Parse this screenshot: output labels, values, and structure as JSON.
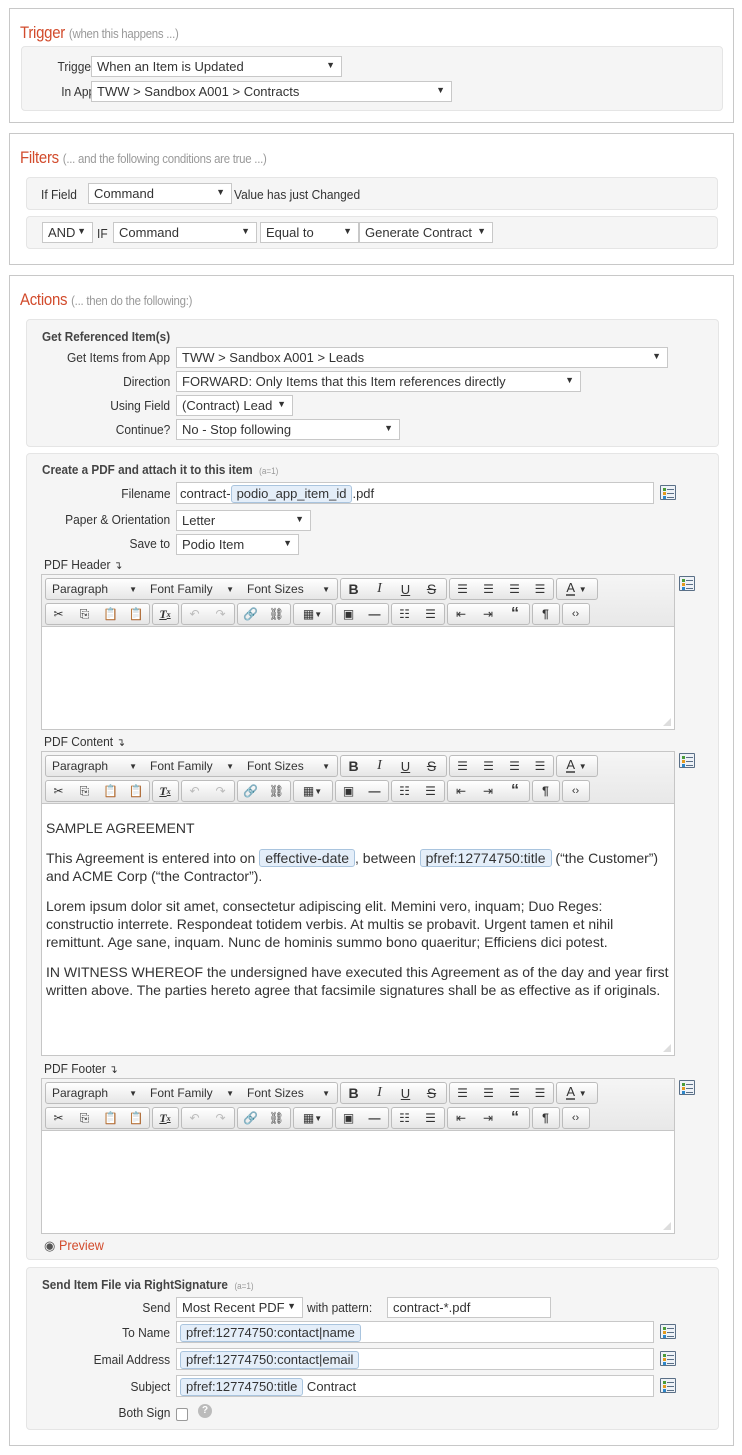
{
  "trigger": {
    "title": "Trigger",
    "subtitle": "(when this happens ...)",
    "trigger_label": "Trigger:",
    "trigger_value": "When an Item is Updated",
    "app_label": "In App:",
    "app_value": "TWW > Sandbox A001 > Contracts"
  },
  "filters": {
    "title": "Filters",
    "subtitle": "(... and the following conditions are true ...)",
    "row1": {
      "if_field_label": "If Field",
      "field": "Command",
      "suffix": "Value has just Changed"
    },
    "row2": {
      "conj": "AND",
      "if_label": "IF",
      "field": "Command",
      "operator": "Equal to",
      "value": "Generate Contract"
    }
  },
  "actions": {
    "title": "Actions",
    "subtitle": "(... then do the following:)",
    "get_ref": {
      "title": "Get Referenced Item(s)",
      "app_label": "Get Items from App",
      "app_value": "TWW > Sandbox A001 > Leads",
      "direction_label": "Direction",
      "direction_value": "FORWARD: Only Items that this Item references directly",
      "field_label": "Using Field",
      "field_value": "(Contract) Lead",
      "continue_label": "Continue?",
      "continue_value": "No - Stop following"
    },
    "pdf": {
      "title": "Create a PDF and attach it to this item",
      "count": "(a=1)",
      "filename_label": "Filename",
      "filename_prefix": "contract-",
      "filename_token": "podio_app_item_id",
      "filename_suffix": ".pdf",
      "paper_label": "Paper & Orientation",
      "paper_value": "Letter",
      "save_label": "Save to",
      "save_value": "Podio Item",
      "header_label": "PDF Header",
      "content_label": "PDF Content",
      "footer_label": "PDF Footer",
      "preview_label": "Preview",
      "toolbar": {
        "paragraph": "Paragraph",
        "font_family": "Font Family",
        "font_sizes": "Font Sizes"
      },
      "content": {
        "heading": "SAMPLE AGREEMENT",
        "p1_a": "This Agreement is entered into on ",
        "p1_token1": "effective-date",
        "p1_b": ", between ",
        "p1_token2": "pfref:12774750:title",
        "p1_c": " (“the Customer”) and ACME Corp (“the Contractor”).",
        "p2": "Lorem ipsum dolor sit amet, consectetur adipiscing elit. Memini vero, inquam; Duo Reges: constructio interrete. Respondeat totidem verbis. At multis se probavit. Urgent tamen et nihil remittunt. Age sane, inquam. Nunc de hominis summo bono quaeritur; Efficiens dici potest.",
        "p3": "IN WITNESS WHEREOF the undersigned have executed this Agreement as of the day and year first written above. The parties hereto agree that facsimile signatures shall be as effective as if originals."
      }
    },
    "rs": {
      "title": "Send Item File via RightSignature",
      "count": "(a=1)",
      "send_label": "Send",
      "send_value": "Most Recent PDF",
      "pattern_label": "with pattern:",
      "pattern_value": "contract-*.pdf",
      "to_name_label": "To Name",
      "to_name_token": "pfref:12774750:contact|name",
      "email_label": "Email Address",
      "email_token": "pfref:12774750:contact|email",
      "subject_label": "Subject",
      "subject_token": "pfref:12774750:title",
      "subject_text": " Contract",
      "both_sign_label": "Both Sign",
      "both_sign_checked": false,
      "help": "?"
    }
  },
  "colors": {
    "accent": "#d24b2c",
    "token_bg": "#e4eef9",
    "token_border": "#a9c4de"
  }
}
